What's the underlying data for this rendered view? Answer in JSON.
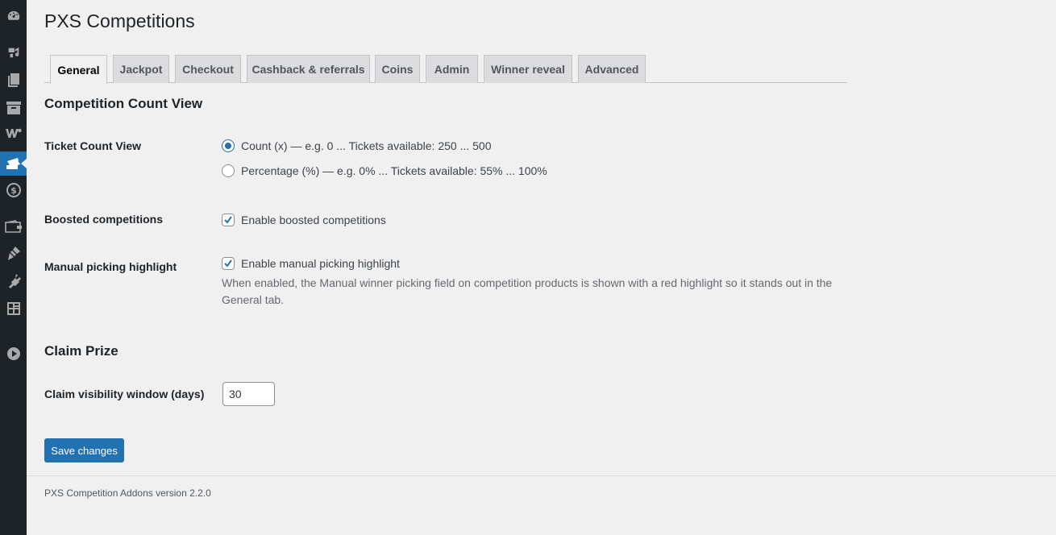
{
  "sidebar": {
    "icons": [
      {
        "name": "dashboard-icon"
      },
      {
        "name": "media-icon"
      },
      {
        "name": "pages-icon"
      },
      {
        "name": "archive-icon"
      },
      {
        "name": "woocommerce-icon"
      },
      {
        "name": "tickets-icon"
      },
      {
        "name": "dollar-icon"
      },
      {
        "name": "wallet-icon"
      },
      {
        "name": "appearance-icon"
      },
      {
        "name": "plugins-icon"
      },
      {
        "name": "tools-icon"
      },
      {
        "name": "play-icon"
      }
    ]
  },
  "header": {
    "title": "PXS Competitions"
  },
  "tabs": [
    {
      "label": "General"
    },
    {
      "label": "Jackpot"
    },
    {
      "label": "Checkout"
    },
    {
      "label": "Cashback & referrals"
    },
    {
      "label": "Coins"
    },
    {
      "label": "Admin"
    },
    {
      "label": "Winner reveal"
    },
    {
      "label": "Advanced"
    }
  ],
  "competition_count_view": {
    "title": "Competition Count View",
    "ticket_count_view": {
      "label": "Ticket Count View",
      "options": [
        {
          "label": "Count (x) — e.g. 0 ... Tickets available: 250 ... 500",
          "checked": true
        },
        {
          "label": "Percentage (%) — e.g. 0% ... Tickets available: 55% ... 100%",
          "checked": false
        }
      ]
    },
    "boosted": {
      "label": "Boosted competitions",
      "checkbox_label": "Enable boosted competitions",
      "checked": true
    },
    "manual_picking": {
      "label": "Manual picking highlight",
      "checkbox_label": "Enable manual picking highlight",
      "checked": true,
      "description": "When enabled, the Manual winner picking field on competition products is shown with a red highlight so it stands out in the General tab."
    }
  },
  "claim_prize": {
    "title": "Claim Prize",
    "visibility": {
      "label": "Claim visibility window (days)",
      "value": "30"
    }
  },
  "actions": {
    "save_label": "Save changes"
  },
  "footer": {
    "version_text": "PXS Competition Addons version 2.2.0"
  },
  "colors": {
    "accent": "#2271b1",
    "sidebar": "#1d2327",
    "background": "#f0f0f1"
  }
}
